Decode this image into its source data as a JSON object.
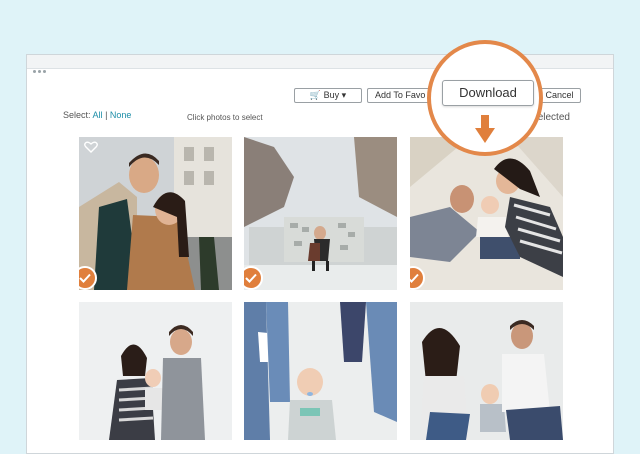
{
  "toolbar": {
    "buy_label": "Buy ▾",
    "favorites_label": "Add To Favo",
    "download_label": "Download",
    "cancel_label": "Cancel"
  },
  "selection": {
    "select_label": "Select:",
    "all_label": "All",
    "separator": "|",
    "none_label": "None",
    "hint": "Click photos to select",
    "count_text": "selected"
  },
  "photos": [
    {
      "subject": "couple-street",
      "selected": true
    },
    {
      "subject": "couple-city",
      "selected": true
    },
    {
      "subject": "family-lying",
      "selected": true
    },
    {
      "subject": "family-standing",
      "selected": false
    },
    {
      "subject": "baby-legs",
      "selected": false
    },
    {
      "subject": "family-sofa",
      "selected": false
    }
  ],
  "colors": {
    "accent": "#e07f3c",
    "link": "#1d8ea8",
    "background": "#dff3f8"
  }
}
